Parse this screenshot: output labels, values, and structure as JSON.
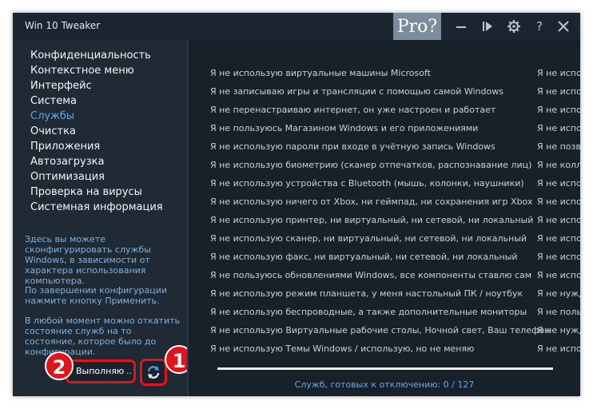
{
  "window": {
    "title": "Win 10 Tweaker",
    "pro_label": "Pro?"
  },
  "titlebar_icons": [
    "minimize-icon",
    "play-icon",
    "gear-icon",
    "help-icon",
    "close-icon"
  ],
  "titlebar_glyphs": {
    "help": "?"
  },
  "sidebar": {
    "items": [
      {
        "label": "Конфиденциальность",
        "active": false
      },
      {
        "label": "Контекстное меню",
        "active": false
      },
      {
        "label": "Интерфейс",
        "active": false
      },
      {
        "label": "Система",
        "active": false
      },
      {
        "label": "Службы",
        "active": true
      },
      {
        "label": "Очистка",
        "active": false
      },
      {
        "label": "Приложения",
        "active": false
      },
      {
        "label": "Автозагрузка",
        "active": false
      },
      {
        "label": "Оптимизация",
        "active": false
      },
      {
        "label": "Проверка на вирусы",
        "active": false
      },
      {
        "label": "Системная информация",
        "active": false
      }
    ],
    "desc1": "Здесь вы можете сконфигурировать службы Windows, в зависимости от характера использования компьютера.",
    "desc2": "По завершении конфигурации нажмите кнопку Применить.",
    "desc3": "В любой момент можно откатить состояние служб на то состояние, которое было до конфигурации.",
    "apply_label": "Выполняю",
    "apply_dots": ".."
  },
  "badges": {
    "one": "1",
    "two": "2"
  },
  "services": [
    {
      "text": "Я не использую виртуальные машины Microsoft",
      "right": "Я не исполь"
    },
    {
      "text": "Я не записываю игры и трансляции с помощью самой Windows",
      "right": "Я не исполь"
    },
    {
      "text": "Я не перенастраиваю интернет, он уже настроен и работает",
      "right": "Я не исполь"
    },
    {
      "text": "Я не пользуюсь Магазином Windows и его приложениями",
      "right": "Я не исполь"
    },
    {
      "text": "Я не использую пароли при входе в учётную запись Windows",
      "right": "Я не позво"
    },
    {
      "text": "Я не использую биометрию (сканер отпечатков, распознавание лиц)",
      "right": "Я не колле"
    },
    {
      "text": "Я не использую устройства с Bluetooth (мышь, колонки, наушники)",
      "right": "Я не исполь"
    },
    {
      "text": "Я не использую ничего от Xbox, ни геймпад, ни сохранения игр Xbox",
      "right": "Я не исполь"
    },
    {
      "text": "Я не использую принтер, ни виртуальный, ни сетевой, ни локальный",
      "right": "Я не исполь"
    },
    {
      "text": "Я не использую сканер, ни виртуальный, ни сетевой, ни локальный",
      "right": "Я не исполь"
    },
    {
      "text": "Я не использую факс, ни виртуальный, ни сетевой, ни локальный",
      "right": "Я не исполь"
    },
    {
      "text": "Я не пользуюсь обновлениями Windows, все компоненты ставлю сам",
      "right": "Я не исполь"
    },
    {
      "text": "Я не использую режим планшета, у меня настольный ПК / ноутбук",
      "right": "Я не нужда"
    },
    {
      "text": "Я не использую беспроводные, а также дополнительные мониторы",
      "right": "Я не польз"
    },
    {
      "text": "Я не использую Виртуальные рабочие столы, Ночной свет, Ваш телефон",
      "right": "Я не нужда"
    },
    {
      "text": "Я не использую Темы Windows / использую, но не меняю",
      "right": "Я не исполь"
    }
  ],
  "status": {
    "count_text": "Служб, готовых к отключению: 0 / 127"
  },
  "colors": {
    "window_bg": "#1f2a35",
    "content_bg": "#18212a",
    "accent": "#5ea7e6",
    "highlight_red": "#e0141a",
    "pro_bg": "#7b8d9c"
  }
}
